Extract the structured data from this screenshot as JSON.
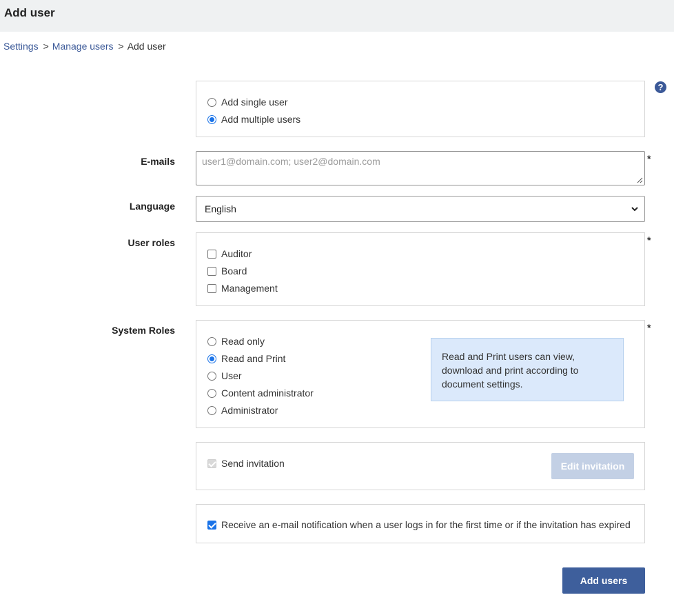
{
  "header": {
    "title": "Add user"
  },
  "breadcrumb": {
    "items": [
      "Settings",
      "Manage users",
      "Add user"
    ],
    "separator": ">"
  },
  "help": {
    "glyph": "?",
    "icon": "question-circle-icon"
  },
  "mode": {
    "options": [
      {
        "label": "Add single user",
        "selected": false
      },
      {
        "label": "Add multiple users",
        "selected": true
      }
    ]
  },
  "emails": {
    "label": "E-mails",
    "placeholder": "user1@domain.com; user2@domain.com",
    "required_mark": "*"
  },
  "language": {
    "label": "Language",
    "value": "English"
  },
  "user_roles": {
    "label": "User roles",
    "required_mark": "*",
    "options": [
      {
        "label": "Auditor",
        "checked": false
      },
      {
        "label": "Board",
        "checked": false
      },
      {
        "label": "Management",
        "checked": false
      }
    ]
  },
  "system_roles": {
    "label": "System Roles",
    "required_mark": "*",
    "options": [
      {
        "label": "Read only",
        "selected": false
      },
      {
        "label": "Read and Print",
        "selected": true
      },
      {
        "label": "User",
        "selected": false
      },
      {
        "label": "Content administrator",
        "selected": false
      },
      {
        "label": "Administrator",
        "selected": false
      }
    ],
    "info": "Read and Print users can view, download and print according to document settings."
  },
  "invitation": {
    "send_label": "Send invitation",
    "send_checked": true,
    "send_disabled": true,
    "edit_label": "Edit invitation"
  },
  "notification": {
    "label": "Receive an e-mail notification when a user logs in for the first time or if the invitation has expired",
    "checked": true
  },
  "actions": {
    "submit_label": "Add users"
  },
  "colors": {
    "accent": "#3e5f9c",
    "link": "#3b5998",
    "info_bg": "#dbe9fb",
    "header_bg": "#eff1f2"
  }
}
